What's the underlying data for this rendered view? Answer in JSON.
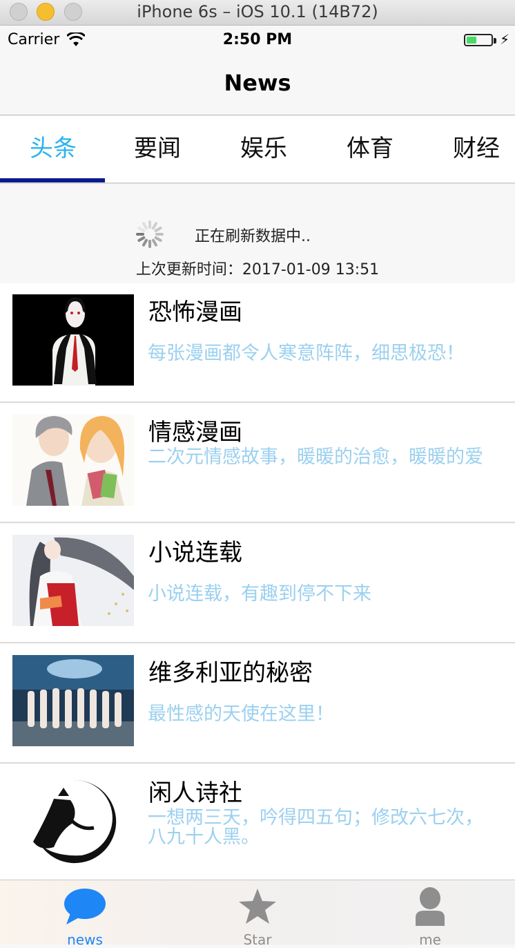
{
  "window": {
    "title": "iPhone 6s – iOS 10.1 (14B72)"
  },
  "status_bar": {
    "carrier": "Carrier",
    "time": "2:50 PM",
    "battery_level": 0.4
  },
  "nav": {
    "title": "News"
  },
  "tabs": [
    {
      "label": "头条",
      "active": true
    },
    {
      "label": "要闻",
      "active": false
    },
    {
      "label": "娱乐",
      "active": false
    },
    {
      "label": "体育",
      "active": false
    },
    {
      "label": "财经",
      "active": false
    }
  ],
  "refresh": {
    "status": "正在刷新数据中..",
    "last_update": "上次更新时间：2017-01-09 13:51"
  },
  "items": [
    {
      "title": "恐怖漫画",
      "subtitle": "每张漫画都令人寒意阵阵，细思极恐！"
    },
    {
      "title": "情感漫画",
      "subtitle": "二次元情感故事，暖暖的治愈，暖暖的爱"
    },
    {
      "title": "小说连载",
      "subtitle": "小说连载，有趣到停不下来"
    },
    {
      "title": "维多利亚的秘密",
      "subtitle": "最性感的天使在这里！"
    },
    {
      "title": "闲人诗社",
      "subtitle": "一想两三天，吟得四五句；修改六七次，八九十人黑。"
    }
  ],
  "tab_bar": [
    {
      "label": "news",
      "icon": "chat-bubble-icon",
      "active": true
    },
    {
      "label": "Star",
      "icon": "star-icon",
      "active": false
    },
    {
      "label": "me",
      "icon": "person-icon",
      "active": false
    }
  ],
  "colors": {
    "accent": "#2ab3f0",
    "tab_underline": "#0b1a8c",
    "subtitle": "#9bd0ef",
    "tab_bar_active": "#1f86f5"
  }
}
